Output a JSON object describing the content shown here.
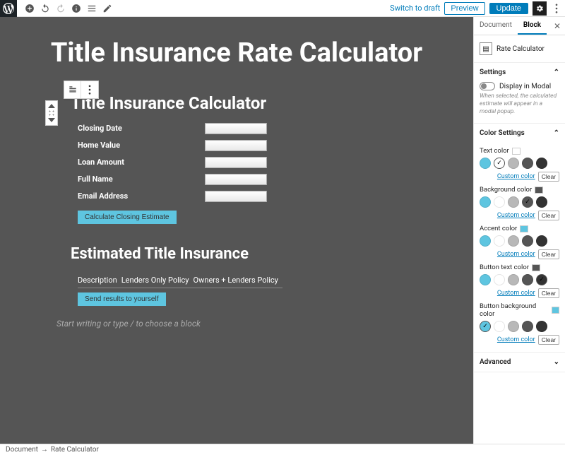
{
  "topbar": {
    "switch_to_draft": "Switch to draft",
    "preview": "Preview",
    "update": "Update"
  },
  "page": {
    "title": "Title Insurance Rate Calculator"
  },
  "calculator": {
    "title": "Title Insurance Calculator",
    "fields": {
      "closing_date": "Closing Date",
      "home_value": "Home Value",
      "loan_amount": "Loan Amount",
      "full_name": "Full Name",
      "email": "Email Address"
    },
    "calc_button": "Calculate Closing Estimate",
    "est_title": "Estimated Title Insurance",
    "cols": {
      "desc": "Description",
      "lenders": "Lenders Only Policy",
      "owners": "Owners + Lenders Policy"
    },
    "send_button": "Send results to yourself"
  },
  "editor": {
    "placeholder": "Start writing or type / to choose a block"
  },
  "sidebar": {
    "tabs": {
      "document": "Document",
      "block": "Block"
    },
    "block_name": "Rate Calculator",
    "settings": {
      "title": "Settings",
      "display_in_modal": "Display in Modal",
      "help": "When selected, the calculated estimate will appear in a modal popup."
    },
    "color_panel": {
      "title": "Color Settings",
      "text_color": "Text color",
      "background_color": "Background color",
      "accent_color": "Accent color",
      "button_text_color": "Button text color",
      "button_bg_color": "Button background color",
      "custom": "Custom color",
      "clear": "Clear"
    },
    "advanced": "Advanced"
  },
  "colors": {
    "swatch1": "#5ec5e0",
    "swatch2": "#ffffff",
    "swatch3": "#b8b8b8",
    "swatch4": "#555555",
    "swatch5": "#333333",
    "sample_bg": "#555555",
    "sample_accent": "#5ec5e0",
    "sample_btn_text": "#555555",
    "sample_btn_bg": "#5ec5e0"
  },
  "footer": {
    "crumb1": "Document",
    "crumb2": "Rate Calculator"
  }
}
